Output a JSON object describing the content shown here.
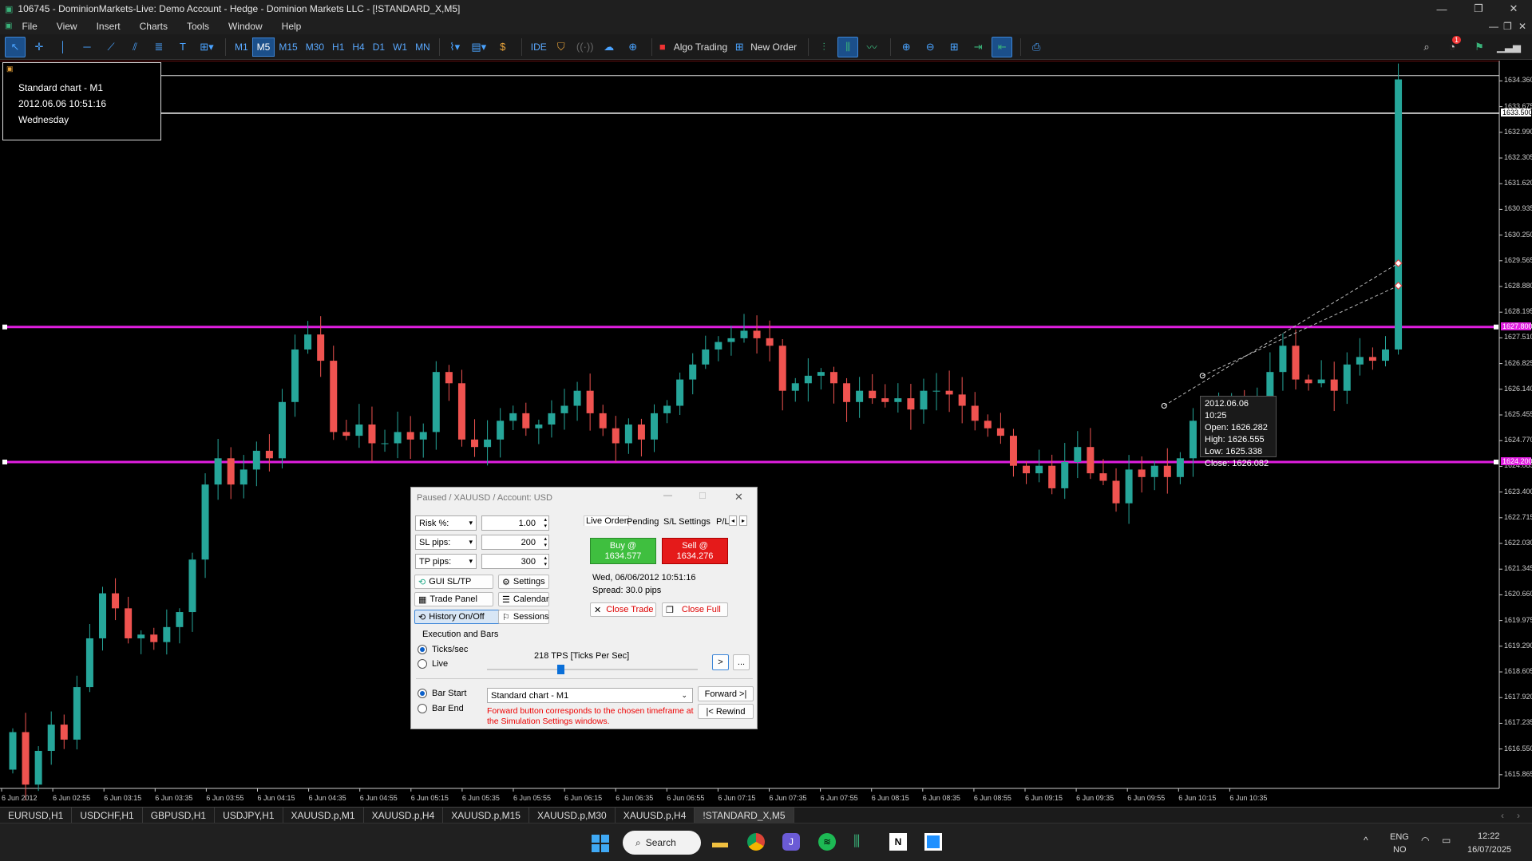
{
  "window": {
    "title": "106745 - DominionMarkets-Live: Demo Account - Hedge - Dominion Markets LLC - [!STANDARD_X,M5]",
    "menu": [
      "File",
      "View",
      "Insert",
      "Charts",
      "Tools",
      "Window",
      "Help"
    ]
  },
  "toolbar": {
    "timeframes": [
      "M1",
      "M5",
      "M15",
      "M30",
      "H1",
      "H4",
      "D1",
      "W1",
      "MN"
    ],
    "active_timeframe": "M5",
    "ide_label": "IDE",
    "algo_trading_label": "Algo Trading",
    "new_order_label": "New Order",
    "notification_count": "1"
  },
  "info_box": {
    "line1": "Standard chart - M1",
    "line2": "2012.06.06 10:51:16",
    "line3": "Wednesday"
  },
  "ohlc_tooltip": {
    "time": "2012.06.06 10:25",
    "open": "Open: 1626.282",
    "high": "High: 1626.555",
    "low": "Low: 1625.338",
    "close": "Close: 1626.082"
  },
  "chart_data": {
    "type": "candlestick",
    "symbol": "XAUUSD",
    "price_ticks": [
      "1634.360",
      "1633.675",
      "1632.990",
      "1632.305",
      "1631.620",
      "1630.935",
      "1630.250",
      "1629.565",
      "1628.880",
      "1628.195",
      "1627.510",
      "1626.825",
      "1626.140",
      "1625.455",
      "1624.770",
      "1624.085",
      "1623.400",
      "1622.715",
      "1622.030",
      "1621.345",
      "1620.660",
      "1619.975",
      "1619.290",
      "1618.605",
      "1617.920",
      "1617.235",
      "1616.550",
      "1615.865"
    ],
    "price_range": [
      1615.5,
      1634.9
    ],
    "line_labels": {
      "white": "1633.500",
      "magenta_top": "1627.800",
      "magenta_bottom": "1624.200"
    },
    "time_ticks": [
      "6 Jun 2012",
      "6 Jun 02:55",
      "6 Jun 03:15",
      "6 Jun 03:35",
      "6 Jun 03:55",
      "6 Jun 04:15",
      "6 Jun 04:35",
      "6 Jun 04:55",
      "6 Jun 05:15",
      "6 Jun 05:35",
      "6 Jun 05:55",
      "6 Jun 06:15",
      "6 Jun 06:35",
      "6 Jun 06:55",
      "6 Jun 07:15",
      "6 Jun 07:35",
      "6 Jun 07:55",
      "6 Jun 08:15",
      "6 Jun 08:35",
      "6 Jun 08:55",
      "6 Jun 09:15",
      "6 Jun 09:35",
      "6 Jun 09:55",
      "6 Jun 10:15",
      "6 Jun 10:35"
    ],
    "levels": {
      "red": 1634.9,
      "white_top": 1634.5,
      "white": 1633.5,
      "magenta_top": 1627.8,
      "magenta_bottom": 1624.2
    },
    "closes": [
      1617.0,
      1615.6,
      1616.5,
      1617.2,
      1616.8,
      1618.2,
      1619.5,
      1620.7,
      1620.3,
      1619.5,
      1619.6,
      1619.4,
      1619.8,
      1620.2,
      1621.6,
      1623.6,
      1624.3,
      1623.6,
      1624.0,
      1624.5,
      1624.3,
      1625.8,
      1627.2,
      1627.6,
      1626.9,
      1625.0,
      1624.9,
      1625.2,
      1624.7,
      1624.7,
      1625.0,
      1624.8,
      1625.0,
      1626.6,
      1626.3,
      1624.8,
      1624.6,
      1624.8,
      1625.3,
      1625.5,
      1625.1,
      1625.2,
      1625.5,
      1625.7,
      1626.1,
      1625.5,
      1625.1,
      1624.7,
      1625.2,
      1624.8,
      1625.5,
      1625.7,
      1626.4,
      1626.8,
      1627.2,
      1627.4,
      1627.5,
      1627.7,
      1627.5,
      1627.3,
      1626.1,
      1626.3,
      1626.5,
      1626.6,
      1626.3,
      1625.8,
      1626.1,
      1625.9,
      1625.8,
      1625.9,
      1625.6,
      1626.1,
      1626.1,
      1626.0,
      1625.7,
      1625.3,
      1625.1,
      1624.9,
      1624.1,
      1623.9,
      1624.1,
      1623.5,
      1624.2,
      1624.6,
      1623.9,
      1623.7,
      1623.1,
      1624.0,
      1623.8,
      1624.1,
      1623.8,
      1624.3,
      1625.3,
      1625.1,
      1625.6,
      1625.6,
      1625.4,
      1625.7,
      1626.6,
      1627.3,
      1626.4,
      1626.3,
      1626.4,
      1626.1,
      1626.8,
      1627.0,
      1626.9,
      1627.2,
      1634.4
    ]
  },
  "bottom_tabs": [
    "EURUSD,H1",
    "USDCHF,H1",
    "GBPUSD,H1",
    "USDJPY,H1",
    "XAUUSD.p,M1",
    "XAUUSD.p,H4",
    "XAUUSD.p,M15",
    "XAUUSD.p,M30",
    "XAUUSD.p,H4",
    "!STANDARD_X,M5"
  ],
  "active_tab": "!STANDARD_X,M5",
  "panel": {
    "title": "Paused / XAUUSD / Account: USD",
    "risk_label": "Risk %:",
    "risk_value": "1.00",
    "sl_label": "SL pips:",
    "sl_value": "200",
    "tp_label": "TP pips:",
    "tp_value": "300",
    "btn_gui_sltp": "GUI SL/TP",
    "btn_trade_panel": "Trade Panel",
    "btn_history": "History On/Off",
    "btn_settings": "Settings",
    "btn_calendar": "Calendar",
    "btn_sessions": "Sessions",
    "tabs": [
      "Live Order",
      "Pending",
      "S/L Settings",
      "P/L"
    ],
    "buy_label": "Buy @",
    "buy_price": "1634.577",
    "sell_label": "Sell @",
    "sell_price": "1634.276",
    "datetime": "Wed, 06/06/2012  10:51:16",
    "spread": "Spread: 30.0 pips",
    "close_trade": "Close Trade",
    "close_full": "Close Full",
    "exec_title": "Execution and Bars",
    "ticks_label": "Ticks/sec",
    "live_label": "Live",
    "tps_label": "218 TPS [Ticks Per Sec]",
    "tps_fraction": 0.35,
    "btn_step": ">",
    "btn_more": "...",
    "bar_start_label": "Bar Start",
    "bar_end_label": "Bar End",
    "chart_select": "Standard chart - M1",
    "btn_forward": "Forward >|",
    "btn_rewind": "|< Rewind",
    "note": "Forward button corresponds to the chosen timeframe at the Simulation Settings windows."
  },
  "taskbar": {
    "search_label": "Search",
    "lang_top": "ENG",
    "lang_bottom": "NO",
    "time": "12:22",
    "date": "16/07/2025"
  }
}
